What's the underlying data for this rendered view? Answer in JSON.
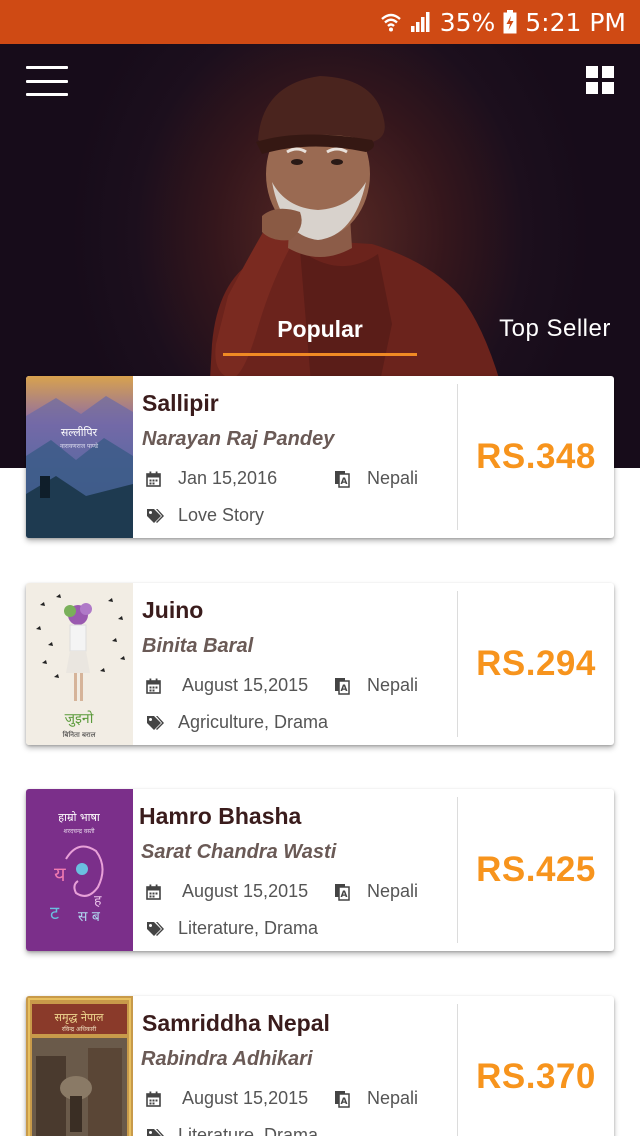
{
  "status_bar": {
    "battery": "35%",
    "time": "5:21 PM"
  },
  "header": {
    "tabs": [
      {
        "label": "Popular",
        "active": true
      },
      {
        "label": "Top Seller",
        "active": false
      }
    ]
  },
  "colors": {
    "accent": "#f08a24",
    "price": "#f7941d",
    "statusbar": "#cf4a14",
    "title": "#3a1c1c"
  },
  "books": [
    {
      "title": "Sallipir",
      "author": "Narayan Raj Pandey",
      "date": "Jan 15,2016",
      "language": "Nepali",
      "genre": "Love Story",
      "price": "RS.348",
      "cover_title": "सल्लीपिर",
      "cover_author": "नारायणराज पाण्डे"
    },
    {
      "title": "Juino",
      "author": "Binita Baral",
      "date": "August 15,2015",
      "language": "Nepali",
      "genre": "Agriculture, Drama",
      "price": "RS.294",
      "cover_title": "जुइनो",
      "cover_author": "बिनिता बराल"
    },
    {
      "title": "Hamro Bhasha",
      "author": "Sarat Chandra Wasti",
      "date": "August 15,2015",
      "language": "Nepali",
      "genre": "Literature, Drama",
      "price": "RS.425",
      "cover_title": "हाम्रो भाषा",
      "cover_author": "शरदचन्द्र वस्ती"
    },
    {
      "title": "Samriddha Nepal",
      "author": "Rabindra Adhikari",
      "date": "August 15,2015",
      "language": "Nepali",
      "genre": "Literature, Drama",
      "price": "RS.370",
      "cover_title": "समृद्ध नेपाल",
      "cover_author": "रविन्द्र अधिकारी"
    }
  ]
}
